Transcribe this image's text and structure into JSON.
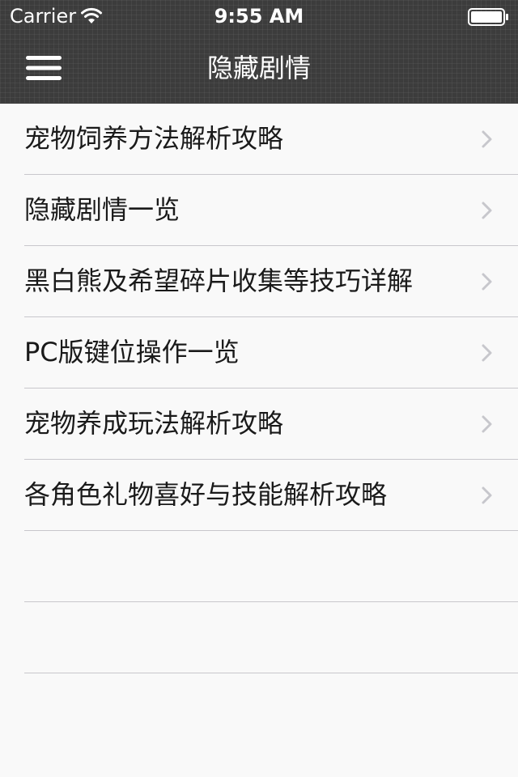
{
  "status_bar": {
    "carrier": "Carrier",
    "time": "9:55 AM",
    "wifi_icon": "wifi-icon",
    "battery_icon": "battery-icon"
  },
  "nav_bar": {
    "title": "隐藏剧情",
    "menu_icon": "hamburger-menu-icon"
  },
  "list": {
    "items": [
      {
        "label": "宠物饲养方法解析攻略"
      },
      {
        "label": "隐藏剧情一览"
      },
      {
        "label": "黑白熊及希望碎片收集等技巧详解"
      },
      {
        "label": "PC版键位操作一览"
      },
      {
        "label": "宠物养成玩法解析攻略"
      },
      {
        "label": "各角色礼物喜好与技能解析攻略"
      },
      {
        "label": ""
      },
      {
        "label": ""
      }
    ],
    "chevron_icon": "chevron-right-icon"
  },
  "colors": {
    "header_bg": "#3c3c3c",
    "list_bg": "#f9f9f9",
    "text": "#1a1a1a",
    "separator": "#c8c7cc",
    "chevron": "#c7c7cc"
  }
}
